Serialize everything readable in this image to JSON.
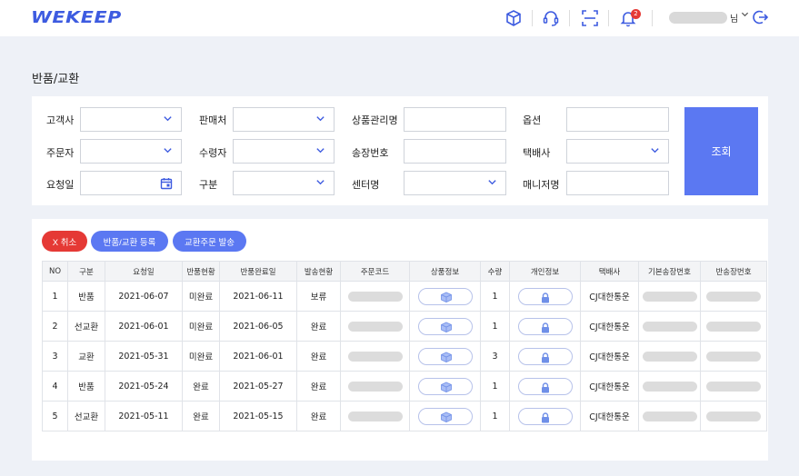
{
  "header": {
    "logo": "WEKEEP",
    "bell_count": "2",
    "user_suffix": "님",
    "icons": [
      "box-icon",
      "headset-icon",
      "scan-icon",
      "bell-icon",
      "logout-icon"
    ]
  },
  "page": {
    "title": "반품/교환"
  },
  "search": {
    "labels": {
      "customer": "고객사",
      "seller": "판매처",
      "product_name": "상품관리명",
      "option": "옵션",
      "orderer": "주문자",
      "receiver": "수령자",
      "invoice_no": "송장번호",
      "courier": "택배사",
      "request_date": "요청일",
      "category": "구분",
      "center": "센터명",
      "manager": "매니저명"
    },
    "values": {
      "customer": "",
      "seller": "",
      "product_name": "",
      "option": "",
      "orderer": "",
      "receiver": "",
      "invoice_no": "",
      "courier": "",
      "request_date": "",
      "category": "",
      "center": "",
      "manager": ""
    },
    "search_button": "조회"
  },
  "actions": {
    "cancel": "X 취소",
    "register": "반품/교환 등록",
    "ship": "교환주문 발송"
  },
  "table": {
    "headers": [
      "NO",
      "구분",
      "요청일",
      "반품현황",
      "반품완료일",
      "발송현황",
      "주문코드",
      "상품정보",
      "수량",
      "개인정보",
      "택배사",
      "기본송장번호",
      "반송장번호"
    ],
    "rows": [
      {
        "no": "1",
        "type": "반품",
        "request_date": "2021-06-07",
        "return_status": "미완료",
        "return_done_date": "2021-06-11",
        "ship_status": "보류",
        "ship_hold": true,
        "qty": "1",
        "courier": "CJ대한통운"
      },
      {
        "no": "2",
        "type": "선교환",
        "request_date": "2021-06-01",
        "return_status": "미완료",
        "return_done_date": "2021-06-05",
        "ship_status": "완료",
        "ship_hold": false,
        "qty": "1",
        "courier": "CJ대한통운"
      },
      {
        "no": "3",
        "type": "교환",
        "request_date": "2021-05-31",
        "return_status": "미완료",
        "return_done_date": "2021-06-01",
        "ship_status": "완료",
        "ship_hold": false,
        "qty": "3",
        "courier": "CJ대한통운"
      },
      {
        "no": "4",
        "type": "반품",
        "request_date": "2021-05-24",
        "return_status": "완료",
        "return_done_date": "2021-05-27",
        "ship_status": "완료",
        "ship_hold": false,
        "qty": "1",
        "courier": "CJ대한통운"
      },
      {
        "no": "5",
        "type": "선교환",
        "request_date": "2021-05-11",
        "return_status": "완료",
        "return_done_date": "2021-05-15",
        "ship_status": "완료",
        "ship_hold": false,
        "qty": "1",
        "courier": "CJ대한통운"
      }
    ]
  },
  "colors": {
    "brand": "#3d5be0",
    "primary_button": "#5b78f2",
    "danger": "#e53935",
    "background": "#eef1f7"
  }
}
